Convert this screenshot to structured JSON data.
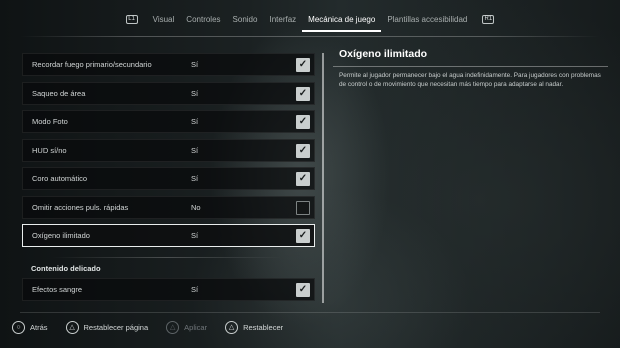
{
  "nav": {
    "left_bumper": "L1",
    "right_bumper": "R1",
    "tabs": [
      {
        "label": "Visual",
        "active": false
      },
      {
        "label": "Controles",
        "active": false
      },
      {
        "label": "Sonido",
        "active": false
      },
      {
        "label": "Interfaz",
        "active": false
      },
      {
        "label": "Mecánica de juego",
        "active": true
      },
      {
        "label": "Plantillas accesibilidad",
        "active": false
      }
    ]
  },
  "settings": [
    {
      "label": "Recordar fuego primario/secundario",
      "value": "Sí",
      "checked": true
    },
    {
      "label": "Saqueo de área",
      "value": "Sí",
      "checked": true
    },
    {
      "label": "Modo Foto",
      "value": "Sí",
      "checked": true
    },
    {
      "label": "HUD sí/no",
      "value": "Sí",
      "checked": true
    },
    {
      "label": "Coro automático",
      "value": "Sí",
      "checked": true
    },
    {
      "label": "Omitir acciones puls. rápidas",
      "value": "No",
      "checked": false
    },
    {
      "label": "Oxígeno ilimitado",
      "value": "Sí",
      "checked": true,
      "selected": true
    }
  ],
  "section": {
    "title": "Contenido delicado",
    "items": [
      {
        "label": "Efectos sangre",
        "value": "Sí",
        "checked": true
      }
    ]
  },
  "description": {
    "title": "Oxígeno ilimitado",
    "text": "Permite al jugador permanecer bajo el agua indefinidamente. Para jugadores con problemas de control o de movimiento que necesitan más tiempo para adaptarse al nadar."
  },
  "footer": {
    "back": {
      "label": "Atrás",
      "icon": "circle-button-icon"
    },
    "reset_page": {
      "label": "Restablecer página",
      "icon": "triangle-button-icon"
    },
    "apply": {
      "label": "Aplicar",
      "icon": "triangle-button-icon",
      "disabled": true
    },
    "reset": {
      "label": "Restablecer",
      "icon": "triangle-button-icon"
    }
  },
  "colors": {
    "accent": "#ffffff",
    "checkbox_on": "#c9cece",
    "disabled": "#70767a"
  }
}
